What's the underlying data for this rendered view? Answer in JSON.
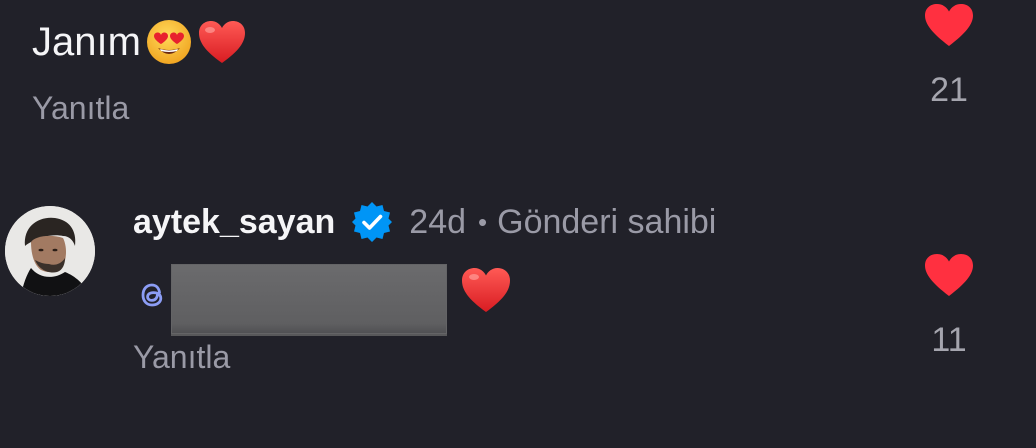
{
  "theme": {
    "background": "#212129",
    "text_primary": "#f5f5f7",
    "text_secondary": "#9a9aa6",
    "like_red": "#ff3040",
    "verified_blue": "#0095f6"
  },
  "comments": [
    {
      "text": "Janım",
      "emojis": [
        "smiling-face-with-heart-eyes",
        "red-heart"
      ],
      "reply_label": "Yanıtla",
      "like_icon": "heart-filled-icon",
      "like_count": "21",
      "liked": true
    },
    {
      "username": "aytek_sayan",
      "verified": true,
      "timestamp": "24d",
      "separator": "•",
      "owner_label": "Gönderi sahibi",
      "mention_icon": "threads-icon",
      "mention_redacted": true,
      "emojis": [
        "red-heart"
      ],
      "reply_label": "Yanıtla",
      "like_icon": "heart-filled-icon",
      "like_count": "11",
      "liked": true
    }
  ]
}
